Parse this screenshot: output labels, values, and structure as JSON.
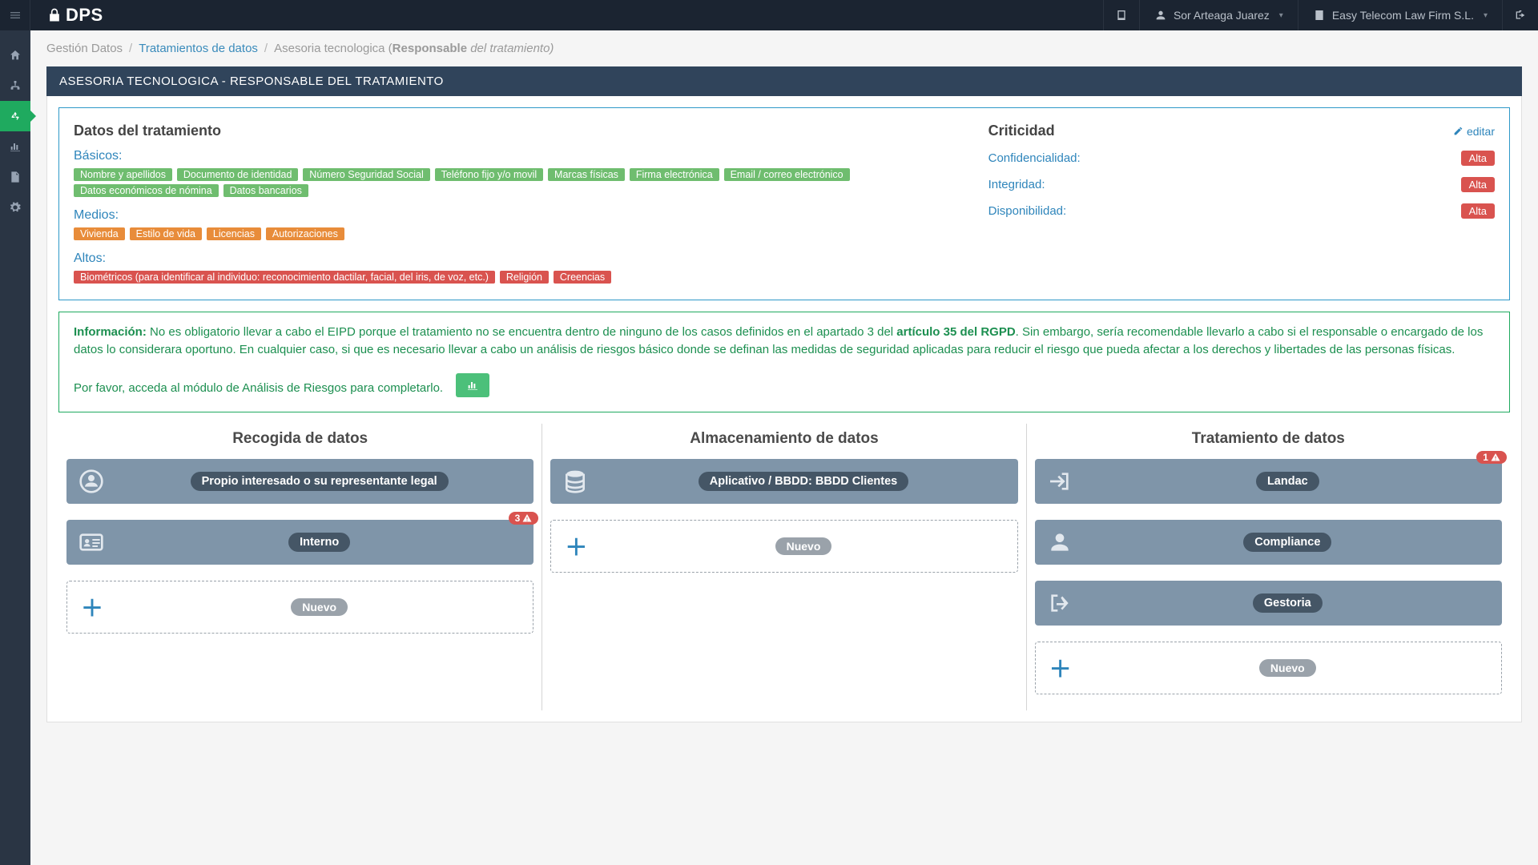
{
  "topbar": {
    "logo_text": "DPS",
    "user_name": "Sor Arteaga Juarez",
    "org_name": "Easy Telecom Law Firm S.L."
  },
  "breadcrumb": {
    "root": "Gestión Datos",
    "link": "Tratamientos de datos",
    "current_prefix": "Asesoria tecnologica (",
    "current_bold": "Responsable",
    "current_italic": " del tratamiento)"
  },
  "titlebar": "ASESORIA TECNOLOGICA - RESPONSABLE DEL TRATAMIENTO",
  "treatment": {
    "heading": "Datos del tratamiento",
    "basicos_label": "Básicos:",
    "basicos": [
      "Nombre y apellidos",
      "Documento de identidad",
      "Número Seguridad Social",
      "Teléfono fijo y/o movil",
      "Marcas físicas",
      "Firma electrónica",
      "Email / correo electrónico",
      "Datos económicos de nómina",
      "Datos bancarios"
    ],
    "medios_label": "Medios:",
    "medios": [
      "Vivienda",
      "Estilo de vida",
      "Licencias",
      "Autorizaciones"
    ],
    "altos_label": "Altos:",
    "altos": [
      "Biométricos (para identificar al individuo: reconocimiento dactilar, facial, del iris, de voz, etc.)",
      "Religión",
      "Creencias"
    ]
  },
  "criticidad": {
    "heading": "Criticidad",
    "edit_label": "editar",
    "conf_label": "Confidencialidad:",
    "conf_value": "Alta",
    "int_label": "Integridad:",
    "int_value": "Alta",
    "disp_label": "Disponibilidad:",
    "disp_value": "Alta"
  },
  "info_alert": {
    "prefix_bold": "Información:",
    "text_pre": " No es obligatorio llevar a cabo el EIPD porque el tratamiento no se encuentra dentro de ninguno de los casos definidos en el apartado 3 del ",
    "link_text": "artículo 35 del RGPD",
    "text_post": ". Sin embargo, sería recomendable llevarlo a cabo si el responsable o encargado de los datos lo considerara oportuno. En cualquier caso, si que es necesario llevar a cabo un análisis de riesgos básico donde se definan las medidas de seguridad aplicadas para reducir el riesgo que pueda afectar a los derechos y libertades de las personas físicas.",
    "p2": "Por favor, acceda al módulo de Análisis de Riesgos para completarlo."
  },
  "columns": {
    "recogida": {
      "title": "Recogida de datos",
      "c1": "Propio interesado o su representante legal",
      "c2": "Interno",
      "c2_warn_count": "3",
      "new_label": "Nuevo"
    },
    "almacen": {
      "title": "Almacenamiento de datos",
      "c1": "Aplicativo / BBDD: BBDD Clientes",
      "new_label": "Nuevo"
    },
    "tratamiento": {
      "title": "Tratamiento de datos",
      "c1": "Landac",
      "c1_warn_count": "1",
      "c2": "Compliance",
      "c3": "Gestoria",
      "new_label": "Nuevo"
    }
  }
}
